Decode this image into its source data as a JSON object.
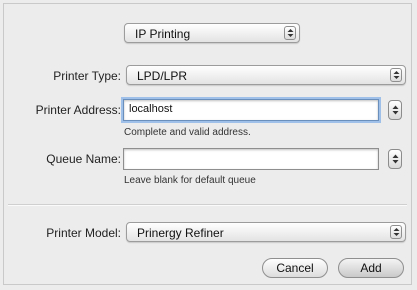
{
  "top_popup": {
    "value": "IP Printing"
  },
  "printer_type": {
    "label": "Printer Type:",
    "value": "LPD/LPR"
  },
  "printer_address": {
    "label": "Printer Address:",
    "value": "localhost",
    "hint": "Complete and valid address."
  },
  "queue_name": {
    "label": "Queue Name:",
    "value": "",
    "hint": "Leave blank for default queue"
  },
  "printer_model": {
    "label": "Printer Model:",
    "value": "Prinergy Refiner"
  },
  "buttons": {
    "cancel": "Cancel",
    "add": "Add"
  },
  "icons": {
    "popup": "up-down-chevron-icon",
    "stepper": "up-down-chevron-icon"
  }
}
